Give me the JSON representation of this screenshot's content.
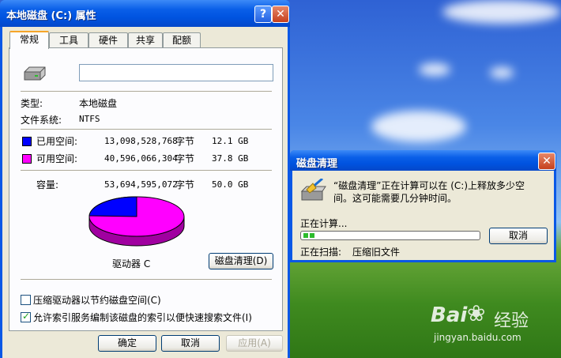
{
  "window": {
    "title": "本地磁盘 (C:) 属性",
    "help_glyph": "?",
    "close_glyph": "✕",
    "tabs": [
      {
        "label": "常规",
        "active": true
      },
      {
        "label": "工具",
        "active": false
      },
      {
        "label": "硬件",
        "active": false
      },
      {
        "label": "共享",
        "active": false
      },
      {
        "label": "配额",
        "active": false
      }
    ]
  },
  "general": {
    "name_value": "",
    "type_label": "类型:",
    "type_value": "本地磁盘",
    "fs_label": "文件系统:",
    "fs_value": "NTFS",
    "used_label": "已用空间:",
    "used_bytes": "13,098,528,768",
    "used_unit": "字节",
    "used_size": "12.1 GB",
    "free_label": "可用空间:",
    "free_bytes": "40,596,066,304",
    "free_unit": "字节",
    "free_size": "37.8 GB",
    "capacity_label": "容量:",
    "capacity_bytes": "53,694,595,072",
    "capacity_unit": "字节",
    "capacity_size": "50.0 GB",
    "drive_label": "驱动器 C",
    "cleanup_button": "磁盘清理(D)",
    "compress_label": "压缩驱动器以节约磁盘空间(C)",
    "compress_checked": false,
    "index_label": "允许索引服务编制该磁盘的索引以便快速搜索文件(I)",
    "index_checked": true,
    "used_fraction": 0.244,
    "colors": {
      "used": "#0000ff",
      "free": "#ff00ff"
    }
  },
  "footer": {
    "ok": "确定",
    "cancel": "取消",
    "apply": "应用(A)"
  },
  "cleanup_dialog": {
    "title": "磁盘清理",
    "message_line1": "“磁盘清理”正在计算可以在 (C:)上释放多少空",
    "message_line2": "间。这可能需要几分钟时间。",
    "status": "正在计算...",
    "cancel": "取消",
    "scanning_label": "正在扫描:",
    "scanning_value": "压缩旧文件",
    "progress_fraction": 0.05
  },
  "watermark": {
    "brand": "Bai",
    "brand2": "经验",
    "url": "jingyan.baidu.com"
  }
}
